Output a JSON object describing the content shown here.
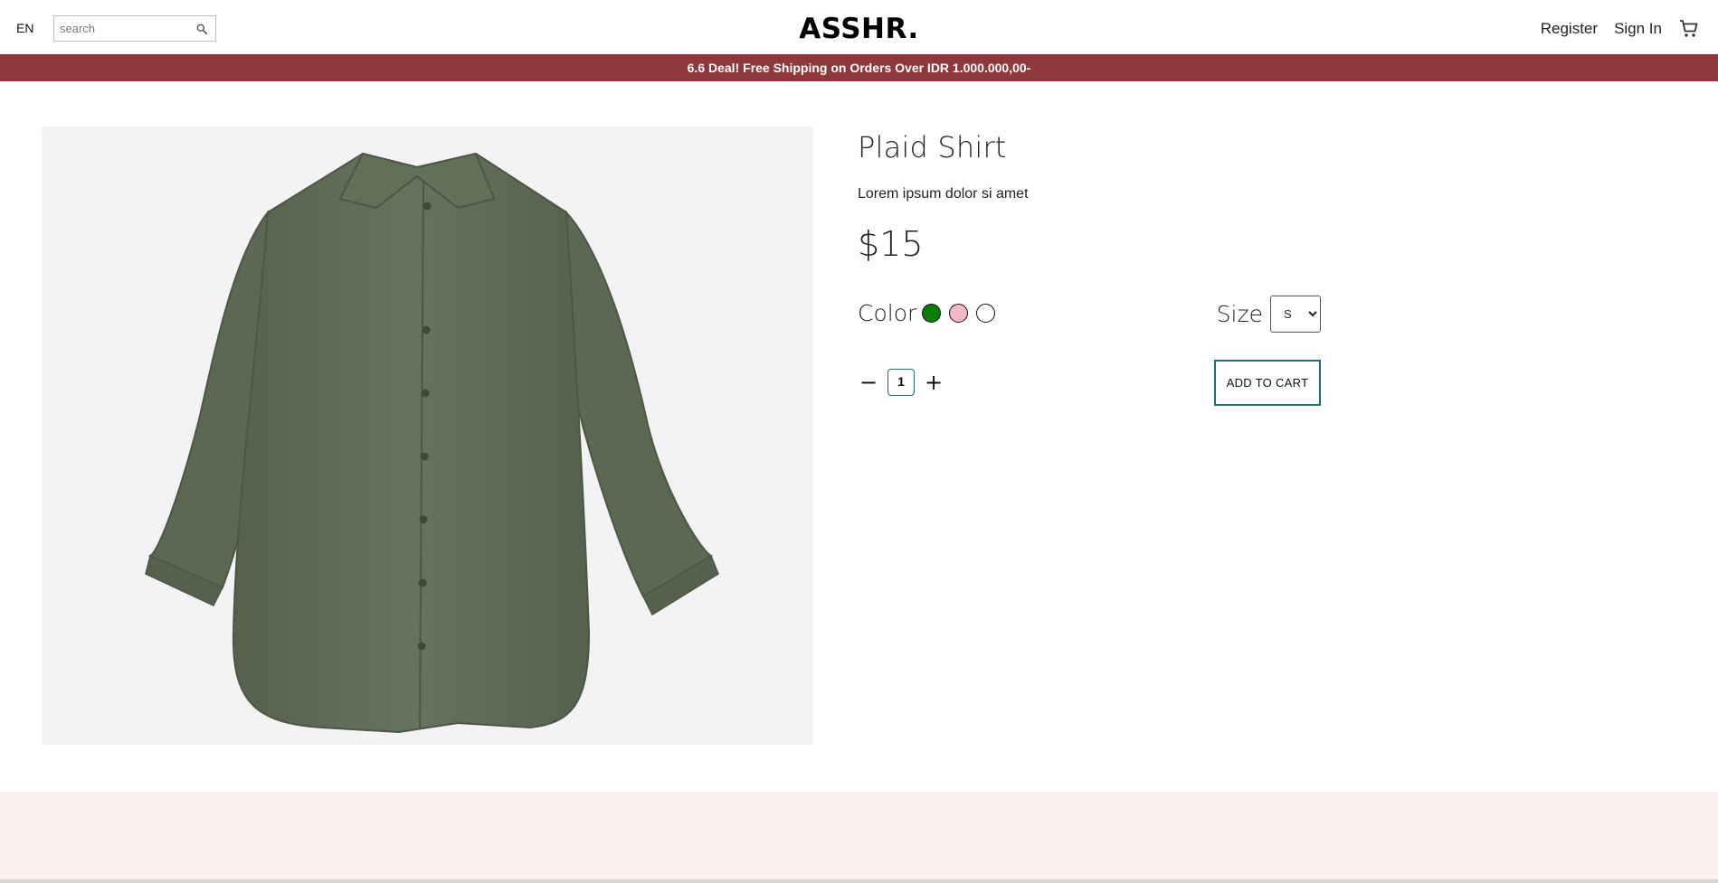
{
  "header": {
    "language": "EN",
    "search_placeholder": "search",
    "logo": "ASSHR.",
    "register_label": "Register",
    "signin_label": "Sign In",
    "cart_icon": "cart-icon",
    "search_icon": "search-icon"
  },
  "promo": {
    "text": "6.6 Deal! Free Shipping on Orders Over IDR 1.000.000,00-",
    "background": "#8f383c"
  },
  "product": {
    "title": "Plaid Shirt",
    "description": "Lorem ipsum dolor si amet",
    "price": "$15",
    "color_label": "Color",
    "colors": [
      "#0a7d0a",
      "#f5b8c5",
      "#ffffff"
    ],
    "size_label": "Size",
    "size_selected": "S",
    "quantity": "1",
    "decrement_label": "−",
    "increment_label": "+",
    "add_to_cart_label": "ADD TO CART",
    "accent_color": "#1a6f80"
  }
}
